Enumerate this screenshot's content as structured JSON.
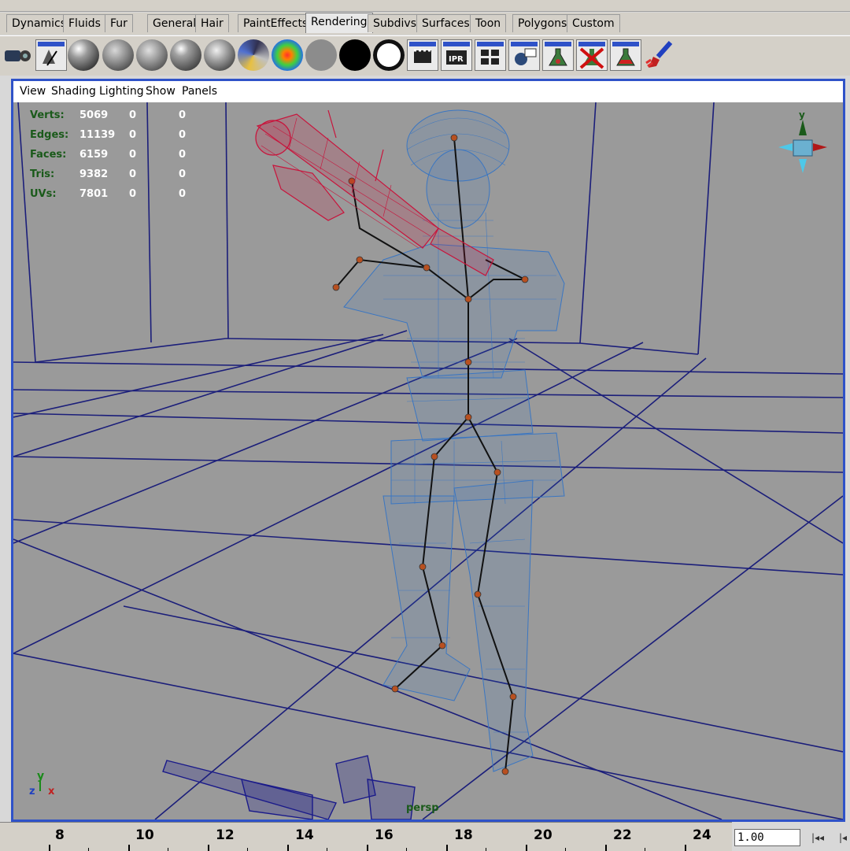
{
  "shelf": {
    "tabs": [
      {
        "label": "Dynamics",
        "active": false
      },
      {
        "label": "Fluids",
        "active": false
      },
      {
        "label": "Fur",
        "active": false
      },
      {
        "label": "General",
        "active": false
      },
      {
        "label": "Hair",
        "active": false
      },
      {
        "label": "PaintEffects",
        "active": false
      },
      {
        "label": "Rendering",
        "active": true
      },
      {
        "label": "Subdivs",
        "active": false
      },
      {
        "label": "Surfaces",
        "active": false
      },
      {
        "label": "Toon",
        "active": false
      },
      {
        "label": "Polygons",
        "active": false
      },
      {
        "label": "Custom",
        "active": false
      }
    ],
    "icons": [
      "camera-aim-icon",
      "render-layer-icon",
      "blinn-shader-icon",
      "lambert-shader-icon",
      "phong-shader-icon",
      "phonge-shader-icon",
      "anisotropic-shader-icon",
      "ramp-shader-icon",
      "rainbow-shader-icon",
      "gray-shader-icon",
      "black-shader-icon",
      "ring-shader-icon",
      "render-view-icon",
      "ipr-render-icon",
      "batch-render-icon",
      "light-bulb-icon",
      "flask-icon",
      "delete-flask-icon",
      "flask-red-icon",
      "paint-brush-icon"
    ]
  },
  "panel_menu": [
    "View",
    "Shading",
    "Lighting",
    "Show",
    "Panels"
  ],
  "hud": [
    {
      "label": "Verts:",
      "values": [
        "5069",
        "0",
        "0"
      ]
    },
    {
      "label": "Edges:",
      "values": [
        "11139",
        "0",
        "0"
      ]
    },
    {
      "label": "Faces:",
      "values": [
        "6159",
        "0",
        "0"
      ]
    },
    {
      "label": "Tris:",
      "values": [
        "9382",
        "0",
        "0"
      ]
    },
    {
      "label": "UVs:",
      "values": [
        "7801",
        "0",
        "0"
      ]
    }
  ],
  "camera_label": "persp",
  "axis": {
    "y": "y",
    "x": "x",
    "z": "z"
  },
  "colors": {
    "viewport_bg": "#9a9a9a",
    "grid": "#1b1e7a",
    "mesh": "#3a76c2",
    "weapon": "#c8143c",
    "frame": "#2f52c8"
  },
  "time_slider": {
    "ticks": [
      "8",
      "10",
      "12",
      "14",
      "16",
      "18",
      "20",
      "22",
      "24"
    ]
  },
  "current_frame": "1.00",
  "playback": {
    "rewind": "|◂◂",
    "step_back": "|◂"
  }
}
